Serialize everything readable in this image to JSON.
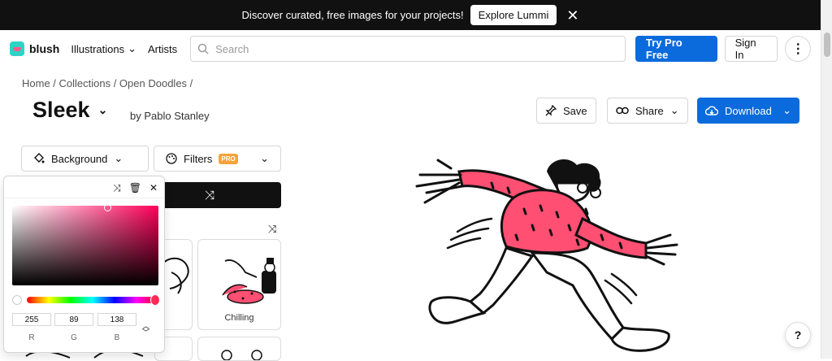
{
  "banner": {
    "text": "Discover curated, free images for your projects!",
    "cta": "Explore Lummi"
  },
  "nav": {
    "brand": "blush",
    "illustrations": "Illustrations",
    "artists": "Artists",
    "search_placeholder": "Search",
    "try_pro": "Try Pro Free",
    "sign_in": "Sign In"
  },
  "breadcrumb": "Home / Collections / Open Doodles /",
  "collection": {
    "title": "Sleek",
    "author": "by Pablo Stanley"
  },
  "actions": {
    "save": "Save",
    "share": "Share",
    "download": "Download"
  },
  "filters": {
    "background": "Background",
    "filters": "Filters",
    "pro_badge": "PRO"
  },
  "color_picker": {
    "r": "255",
    "g": "89",
    "b": "138",
    "r_label": "R",
    "g_label": "G",
    "b_label": "B",
    "selected_color": "#ff598a"
  },
  "gallery": {
    "items": [
      {
        "label": "Chilling"
      }
    ]
  },
  "help": "?",
  "colors": {
    "accent_blue": "#0b6bdc",
    "sweater_pink": "#ff4f72",
    "pro_orange": "#f7a23a"
  }
}
